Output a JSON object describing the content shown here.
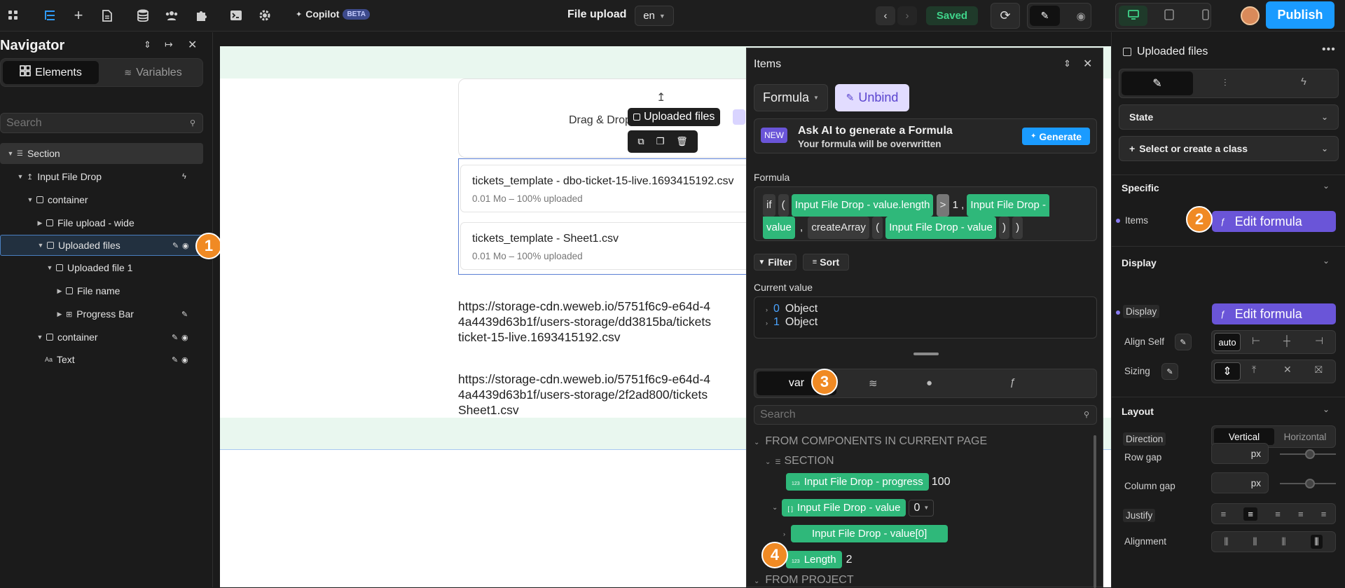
{
  "topbar": {
    "copilot": "Copilot",
    "beta": "BETA",
    "page_title": "File upload",
    "lang": "en",
    "saved": "Saved",
    "publish": "Publish"
  },
  "navigator": {
    "title": "Navigator",
    "tab_elements": "Elements",
    "tab_variables": "Variables",
    "search_placeholder": "Search",
    "tree": [
      {
        "label": "Section"
      },
      {
        "label": "Input File Drop"
      },
      {
        "label": "container"
      },
      {
        "label": "File upload - wide"
      },
      {
        "label": "Uploaded files"
      },
      {
        "label": "Uploaded file 1"
      },
      {
        "label": "File name"
      },
      {
        "label": "Progress Bar"
      },
      {
        "label": "container"
      },
      {
        "label": "Text"
      }
    ]
  },
  "steps": {
    "s1": "1",
    "s2": "2",
    "s3": "3",
    "s4": "4"
  },
  "canvas": {
    "drop_text": "Drag & Drop",
    "selected_label": "Uploaded files",
    "files": [
      {
        "name": "tickets_template - dbo-ticket-15-live.1693415192.csv",
        "meta": "0.01 Mo – 100% uploaded"
      },
      {
        "name": "tickets_template - Sheet1.csv",
        "meta": "0.01 Mo – 100% uploaded"
      }
    ],
    "url1_l1": "https://storage-cdn.weweb.io/5751f6c9-e64d-4",
    "url1_l2": "4a4439d63b1f/users-storage/dd3815ba/tickets",
    "url1_l3": "ticket-15-live.1693415192.csv",
    "url2_l1": "https://storage-cdn.weweb.io/5751f6c9-e64d-4",
    "url2_l2": "4a4439d63b1f/users-storage/2f2ad800/tickets",
    "url2_l3": "Sheet1.csv"
  },
  "items_panel": {
    "title": "Items",
    "formula_btn": "Formula",
    "unbind_btn": "Unbind",
    "ai_new": "NEW",
    "ai_title": "Ask AI to generate a Formula",
    "ai_sub": "Your formula will be overwritten",
    "generate": "Generate",
    "formula_label": "Formula",
    "f_if": "if",
    "f_paren_open": "(",
    "f_chip1": "Input File Drop - value.length",
    "f_gt": ">",
    "f_one": "1",
    "f_comma": ",",
    "f_chip2a": "Input File Drop -",
    "f_chip2b": "value",
    "f_comma2": ",",
    "f_create": "createArray",
    "f_paren2": "(",
    "f_chip3": "Input File Drop - value",
    "f_close1": ")",
    "f_close2": ")",
    "filter": "Filter",
    "sort": "Sort",
    "current_value_label": "Current value",
    "cv0_idx": "0",
    "cv0_val": "Object",
    "cv1_idx": "1",
    "cv1_val": "Object",
    "tab_var": "var",
    "search_placeholder": "Search",
    "group_components": "FROM COMPONENTS IN CURRENT PAGE",
    "group_section": "SECTION",
    "var_progress": "Input File Drop - progress",
    "var_progress_val": "100",
    "var_value": "Input File Drop - value",
    "var_value_sel": "0",
    "var_value0": "Input File Drop - value[0]",
    "var_length": "Length",
    "var_length_val": "2",
    "group_project": "FROM PROJECT"
  },
  "right_panel": {
    "title": "Uploaded files",
    "state": "State",
    "class_select": "Select or create a class",
    "specific": "Specific",
    "items_label": "Items",
    "edit_formula": "Edit formula",
    "display_section": "Display",
    "display_label": "Display",
    "edit_formula2": "Edit formula",
    "align_self": "Align Self",
    "align_auto": "auto",
    "sizing": "Sizing",
    "layout": "Layout",
    "direction": "Direction",
    "vertical": "Vertical",
    "horizontal": "Horizontal",
    "row_gap": "Row gap",
    "row_gap_unit": "px",
    "column_gap": "Column gap",
    "column_gap_unit": "px",
    "justify": "Justify",
    "alignment": "Alignment"
  },
  "colors": {
    "accent": "#1a9bff",
    "brand_green": "#2fb87a",
    "purple": "#6a55d8",
    "step_orange": "#f08a24"
  }
}
